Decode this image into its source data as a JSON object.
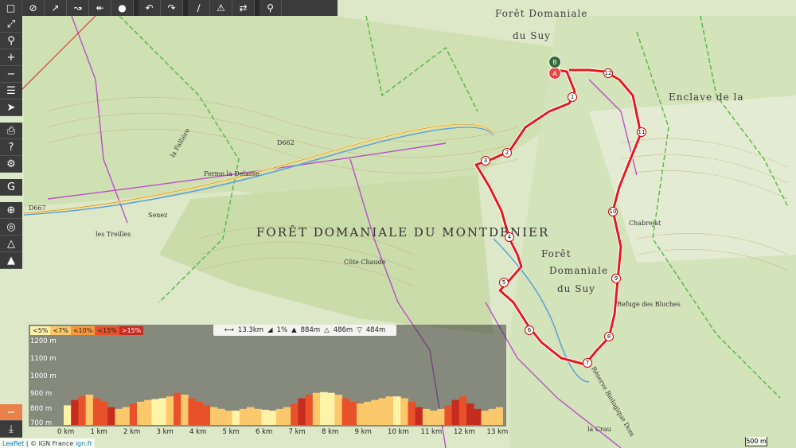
{
  "toolbar": {
    "icons": [
      "select-icon",
      "hide-icon",
      "draw-line-icon",
      "route-icon",
      "hiking-route-icon",
      "bike-route-icon",
      "undo-icon",
      "redo-icon",
      "node-icon",
      "split-icon",
      "reverse-icon",
      "waypoint-icon"
    ]
  },
  "sidebar": {
    "icons": [
      "fullscreen-icon",
      "zoom-search-icon",
      "zoom-in-icon",
      "zoom-out-icon",
      "layers-icon",
      "locate-icon",
      "print-icon",
      "help-icon",
      "google-icon",
      "crosshair-icon",
      "globe-icon",
      "terrain-icon",
      "settings-icon",
      "elevation-icon",
      "download-icon"
    ]
  },
  "map": {
    "labels": {
      "foret_suy_top": "Forêt Domaniale",
      "du_suy_top": "du Suy",
      "foret_montdenier": "FORÊT DOMANIALE DU MONTDENIER",
      "foret_suy_mid1": "Forêt",
      "foret_suy_mid2": "Domaniale",
      "foret_suy_mid3": "du Suy",
      "enclave": "Enclave de la",
      "cote_chaude": "Côte Chaude",
      "la_falliere": "la Fallière",
      "ferme_delasse": "Ferme la Delasse",
      "senez": "Senez",
      "les_treilles": "les Treilles",
      "reserve": "Réserve Biologique Dom",
      "la_crau": "la Crau",
      "refuge": "Refuge des Bluches",
      "chabrejat": "Chabrejat",
      "d667": "D667",
      "d662": "D662"
    },
    "markers": {
      "start": "A",
      "end": "B"
    },
    "km_markers": [
      "1",
      "2",
      "3",
      "4",
      "5",
      "6",
      "7",
      "8",
      "9",
      "10",
      "11",
      "12"
    ],
    "route_color": "#e31a1c"
  },
  "elevation": {
    "legend": [
      "<5%",
      "<7%",
      "<10%",
      "<15%",
      ">15%"
    ],
    "legend_colors": [
      "#fff3a8",
      "#fbc86b",
      "#f59a3a",
      "#e8522a",
      "#c62b1f"
    ],
    "stats": {
      "distance": "13.3km",
      "slope": "1%",
      "max_alt": "884m",
      "climb": "486m",
      "descent": "484m"
    },
    "y_labels": [
      "1200 m",
      "1100 m",
      "1000 m",
      "900 m",
      "800 m",
      "700 m"
    ],
    "x_labels": [
      "0 km",
      "1 km",
      "2 km",
      "3 km",
      "4 km",
      "5 km",
      "6 km",
      "7 km",
      "8 km",
      "9 km",
      "10 km",
      "11 km",
      "12 km",
      "13 km"
    ],
    "profile": [
      810,
      840,
      860,
      870,
      850,
      830,
      800,
      790,
      800,
      820,
      830,
      840,
      845,
      850,
      860,
      880,
      870,
      850,
      830,
      810,
      800,
      790,
      780,
      780,
      790,
      800,
      790,
      785,
      780,
      790,
      800,
      820,
      850,
      870,
      880,
      884,
      880,
      870,
      850,
      830,
      820,
      830,
      840,
      850,
      860,
      860,
      850,
      830,
      800,
      790,
      780,
      790,
      810,
      840,
      860,
      820,
      790,
      780,
      790,
      800
    ]
  },
  "attribution": {
    "leaflet": "Leaflet",
    "sep": " | © IGN France ",
    "ign": "ign.fr"
  },
  "scale": {
    "label": "500 m"
  }
}
